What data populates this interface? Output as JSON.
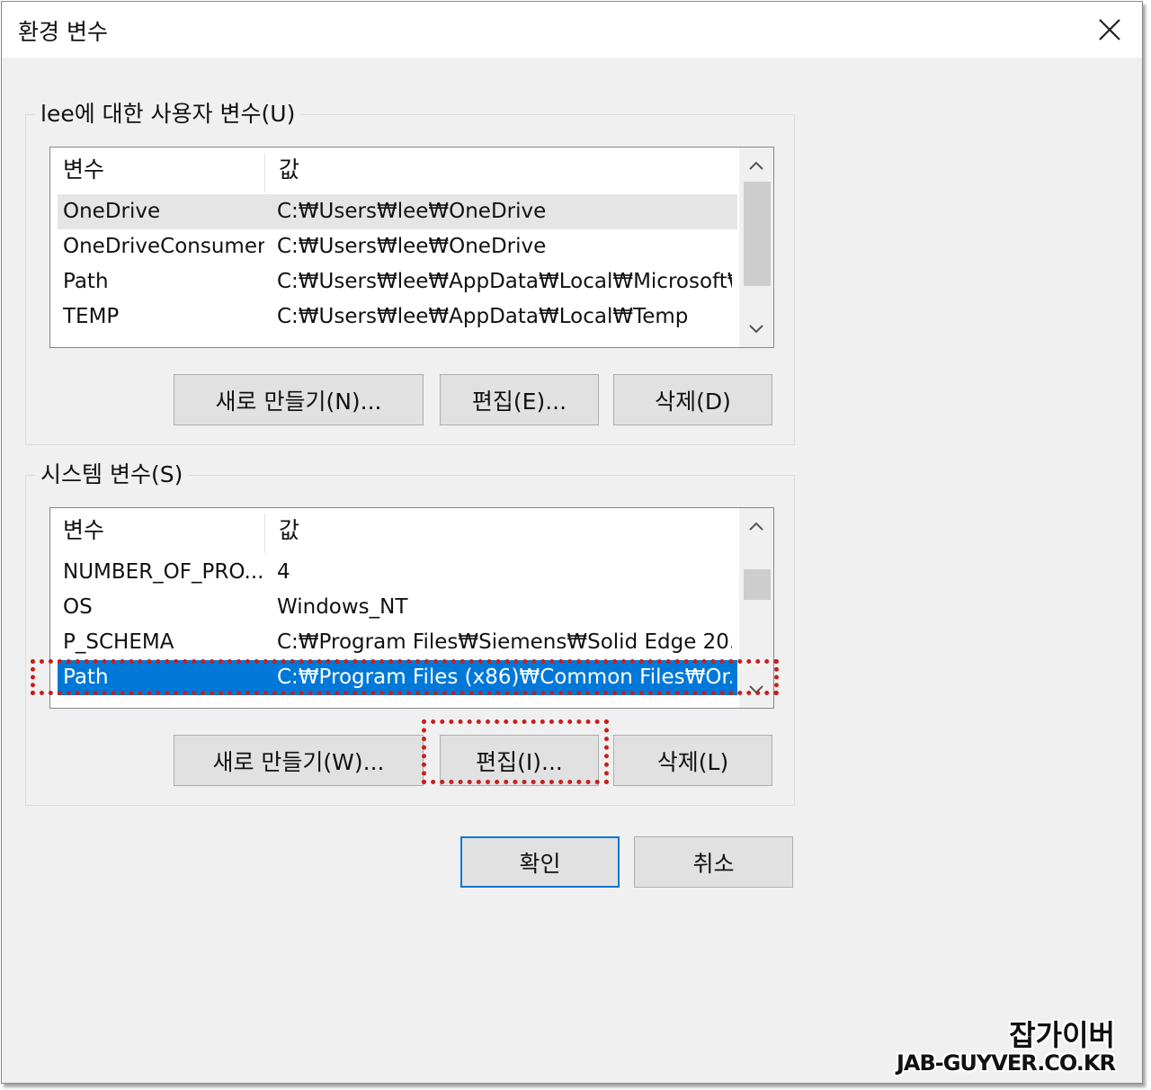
{
  "window": {
    "title": "환경 변수",
    "close_icon": "close-icon"
  },
  "user_vars": {
    "group_label": "lee에 대한 사용자 변수(U)",
    "columns": [
      "변수",
      "값"
    ],
    "rows": [
      {
        "name": "OneDrive",
        "value": "C:₩Users₩lee₩OneDrive"
      },
      {
        "name": "OneDriveConsumer",
        "value": "C:₩Users₩lee₩OneDrive"
      },
      {
        "name": "Path",
        "value": "C:₩Users₩lee₩AppData₩Local₩Microsoft₩..."
      },
      {
        "name": "TEMP",
        "value": "C:₩Users₩lee₩AppData₩Local₩Temp"
      }
    ],
    "buttons": {
      "new": "새로 만들기(N)...",
      "edit": "편집(E)...",
      "delete": "삭제(D)"
    }
  },
  "system_vars": {
    "group_label": "시스템 변수(S)",
    "columns": [
      "변수",
      "값"
    ],
    "rows": [
      {
        "name": "NUMBER_OF_PRO...",
        "value": "4"
      },
      {
        "name": "OS",
        "value": "Windows_NT"
      },
      {
        "name": "P_SCHEMA",
        "value": "C:₩Program Files₩Siemens₩Solid Edge 20..."
      },
      {
        "name": "Path",
        "value": "C:₩Program Files (x86)₩Common Files₩Or..."
      }
    ],
    "selected_row": 3,
    "buttons": {
      "new": "새로 만들기(W)...",
      "edit": "편집(I)...",
      "delete": "삭제(L)"
    }
  },
  "footer": {
    "ok": "확인",
    "cancel": "취소"
  },
  "watermark": {
    "line1": "잡가이버",
    "line2": "JAB-GUYVER.CO.KR"
  },
  "colors": {
    "selection": "#0078d7",
    "annotation": "#c81e1e",
    "dialog_bg": "#f0f0f0"
  }
}
